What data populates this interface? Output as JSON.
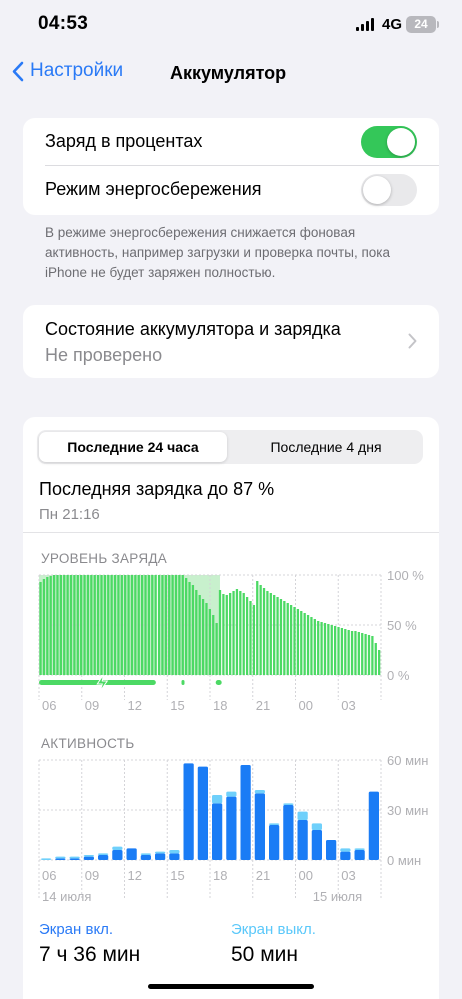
{
  "status": {
    "time": "04:53",
    "network": "4G",
    "battery": "24"
  },
  "nav": {
    "back_label": "Настройки",
    "title": "Аккумулятор"
  },
  "toggles": {
    "percent_label": "Заряд в процентах",
    "percent_on": true,
    "saver_label": "Режим энергосбережения",
    "saver_on": false
  },
  "footnote": "В режиме энергосбережения снижается фоновая активность, например загрузки и проверка почты, пока iPhone не будет заряжен полностью.",
  "health": {
    "title": "Состояние аккумулятора и зарядка",
    "status": "Не проверено"
  },
  "usage": {
    "tabs": [
      "Последние 24 часа",
      "Последние 4 дня"
    ],
    "active_tab": 0,
    "last_charge": "Последняя зарядка до 87 %",
    "last_charge_time": "Пн 21:16",
    "level_title": "УРОВЕНЬ ЗАРЯДА",
    "activity_title": "АКТИВНОСТЬ",
    "screen_on_label": "Экран вкл.",
    "screen_on_value": "7 ч 36 мин",
    "screen_off_label": "Экран выкл.",
    "screen_off_value": "50 мин"
  },
  "colors": {
    "accent": "#2a7af6",
    "green": "#34c759",
    "battery_green": "#4cd964",
    "charge_bg": "#c8f0cd",
    "bar_blue": "#1a7cf5",
    "bar_light": "#6fd0fb"
  },
  "chart_data": [
    {
      "type": "bar",
      "title": "УРОВЕНЬ ЗАРЯДА",
      "x_tick_labels": [
        "06",
        "09",
        "12",
        "15",
        "18",
        "21",
        "00",
        "03"
      ],
      "y_tick_labels": [
        "100 %",
        "50 %",
        "0 %"
      ],
      "ylim": [
        0,
        100
      ],
      "series": [
        {
          "values": [
            93,
            96,
            98,
            99,
            100,
            100,
            100,
            100,
            100,
            100,
            100,
            100,
            100,
            100,
            100,
            100,
            100,
            100,
            100,
            100,
            100,
            100,
            100,
            100,
            100,
            100,
            100,
            100,
            100,
            100,
            100,
            100,
            100,
            100,
            100,
            100,
            100,
            100,
            100,
            100,
            100,
            100,
            100,
            97,
            93,
            90,
            85,
            80,
            76,
            72,
            66,
            60,
            52,
            85,
            81,
            80,
            82,
            84,
            86,
            84,
            82,
            78,
            74,
            70,
            94,
            90,
            87,
            84,
            82,
            80,
            78,
            76,
            74,
            72,
            70,
            68,
            66,
            64,
            62,
            60,
            58,
            56,
            54,
            53,
            52,
            51,
            50,
            49,
            48,
            47,
            46,
            45,
            44,
            44,
            43,
            42,
            41,
            40,
            39,
            32,
            25
          ]
        }
      ],
      "charging_spans_hours": [
        [
          0,
          8.2
        ],
        [
          8.5,
          12.7
        ]
      ]
    },
    {
      "type": "bar",
      "title": "АКТИВНОСТЬ",
      "categories": [
        "05",
        "06",
        "07",
        "08",
        "09",
        "10",
        "11",
        "12",
        "13",
        "14",
        "15",
        "16",
        "17",
        "18",
        "19",
        "20",
        "21",
        "22",
        "23",
        "00",
        "01",
        "02",
        "03",
        "04"
      ],
      "x_tick_labels": [
        "06",
        "09",
        "12",
        "15",
        "18",
        "21",
        "00",
        "03"
      ],
      "date_labels": [
        "14 июля",
        "15 июля"
      ],
      "y_tick_labels": [
        "60 мин",
        "30 мин",
        "0 мин"
      ],
      "ylim": [
        0,
        60
      ],
      "series": [
        {
          "name": "Экран вкл.",
          "values": [
            0,
            1,
            1,
            2,
            3,
            6,
            7,
            3,
            4,
            4,
            58,
            56,
            34,
            38,
            57,
            40,
            21,
            33,
            24,
            18,
            12,
            5,
            6,
            41
          ]
        },
        {
          "name": "Экран выкл.",
          "values": [
            1,
            1,
            1,
            1,
            1,
            2,
            0,
            1,
            1,
            2,
            0,
            0,
            5,
            3,
            0,
            2,
            1,
            1,
            5,
            4,
            0,
            2,
            1,
            0
          ]
        }
      ]
    }
  ]
}
